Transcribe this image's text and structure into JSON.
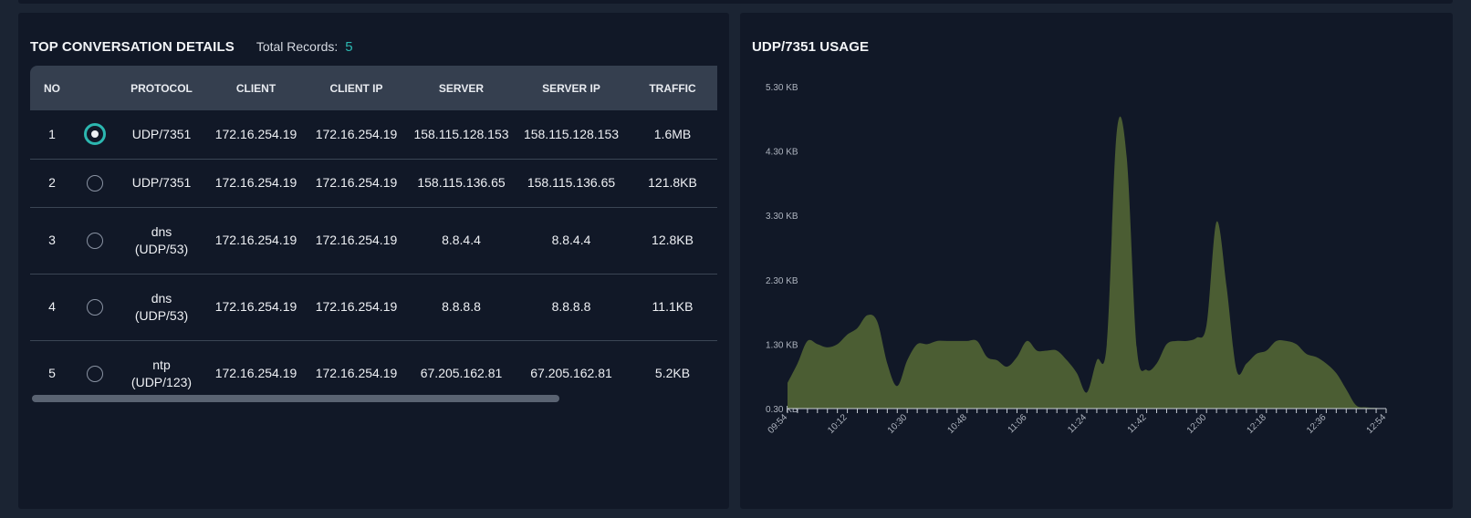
{
  "conversation_panel": {
    "title": "TOP CONVERSATION DETAILS",
    "records_label": "Total Records:",
    "records_count": "5",
    "columns": [
      "NO",
      "",
      "PROTOCOL",
      "CLIENT",
      "CLIENT IP",
      "SERVER",
      "SERVER IP",
      "TRAFFIC"
    ],
    "rows": [
      {
        "no": "1",
        "selected": true,
        "protocol_line1": "UDP/7351",
        "protocol_line2": "",
        "client": "172.16.254.19",
        "client_ip": "172.16.254.19",
        "server": "158.115.128.153",
        "server_ip": "158.115.128.153",
        "traffic": "1.6MB"
      },
      {
        "no": "2",
        "selected": false,
        "protocol_line1": "UDP/7351",
        "protocol_line2": "",
        "client": "172.16.254.19",
        "client_ip": "172.16.254.19",
        "server": "158.115.136.65",
        "server_ip": "158.115.136.65",
        "traffic": "121.8KB"
      },
      {
        "no": "3",
        "selected": false,
        "protocol_line1": "dns",
        "protocol_line2": "(UDP/53)",
        "client": "172.16.254.19",
        "client_ip": "172.16.254.19",
        "server": "8.8.4.4",
        "server_ip": "8.8.4.4",
        "traffic": "12.8KB"
      },
      {
        "no": "4",
        "selected": false,
        "protocol_line1": "dns",
        "protocol_line2": "(UDP/53)",
        "client": "172.16.254.19",
        "client_ip": "172.16.254.19",
        "server": "8.8.8.8",
        "server_ip": "8.8.8.8",
        "traffic": "11.1KB"
      },
      {
        "no": "5",
        "selected": false,
        "protocol_line1": "ntp",
        "protocol_line2": "(UDP/123)",
        "client": "172.16.254.19",
        "client_ip": "172.16.254.19",
        "server": "67.205.162.81",
        "server_ip": "67.205.162.81",
        "traffic": "5.2KB"
      }
    ]
  },
  "usage_panel": {
    "title": "UDP/7351 USAGE"
  },
  "chart_data": {
    "type": "area",
    "title": "UDP/7351 USAGE",
    "xlabel": "",
    "ylabel": "",
    "color": "#4b5d33",
    "ylim": [
      0.3,
      5.3
    ],
    "y_ticks": [
      "0.30 KB",
      "1.30 KB",
      "2.30 KB",
      "3.30 KB",
      "4.30 KB",
      "5.30 KB"
    ],
    "y_tick_values": [
      0.3,
      1.3,
      2.3,
      3.3,
      4.3,
      5.3
    ],
    "x_tick_labels": [
      "09:54",
      "10:12",
      "10:30",
      "10:48",
      "11:06",
      "11:24",
      "11:42",
      "12:00",
      "12:18",
      "12:36",
      "12:54"
    ],
    "x_range_minutes": [
      594,
      774
    ],
    "points": [
      [
        594,
        0.7
      ],
      [
        597,
        1.0
      ],
      [
        600,
        1.35
      ],
      [
        603,
        1.3
      ],
      [
        606,
        1.25
      ],
      [
        609,
        1.3
      ],
      [
        612,
        1.45
      ],
      [
        615,
        1.55
      ],
      [
        618,
        1.75
      ],
      [
        621,
        1.65
      ],
      [
        624,
        1.0
      ],
      [
        627,
        0.65
      ],
      [
        630,
        1.05
      ],
      [
        633,
        1.3
      ],
      [
        636,
        1.3
      ],
      [
        639,
        1.35
      ],
      [
        642,
        1.35
      ],
      [
        645,
        1.35
      ],
      [
        648,
        1.35
      ],
      [
        651,
        1.35
      ],
      [
        654,
        1.1
      ],
      [
        657,
        1.05
      ],
      [
        660,
        0.95
      ],
      [
        663,
        1.1
      ],
      [
        666,
        1.35
      ],
      [
        669,
        1.2
      ],
      [
        672,
        1.2
      ],
      [
        675,
        1.2
      ],
      [
        678,
        1.05
      ],
      [
        681,
        0.85
      ],
      [
        684,
        0.55
      ],
      [
        687,
        1.05
      ],
      [
        690,
        1.3
      ],
      [
        693,
        4.6
      ],
      [
        696,
        4.2
      ],
      [
        699,
        1.25
      ],
      [
        702,
        0.9
      ],
      [
        705,
        1.0
      ],
      [
        708,
        1.3
      ],
      [
        711,
        1.35
      ],
      [
        714,
        1.35
      ],
      [
        717,
        1.4
      ],
      [
        720,
        1.6
      ],
      [
        723,
        3.2
      ],
      [
        726,
        2.2
      ],
      [
        729,
        0.9
      ],
      [
        732,
        1.0
      ],
      [
        735,
        1.15
      ],
      [
        738,
        1.2
      ],
      [
        741,
        1.35
      ],
      [
        744,
        1.35
      ],
      [
        747,
        1.3
      ],
      [
        750,
        1.15
      ],
      [
        753,
        1.1
      ],
      [
        756,
        1.0
      ],
      [
        759,
        0.85
      ],
      [
        762,
        0.6
      ],
      [
        765,
        0.35
      ],
      [
        768,
        0.32
      ],
      [
        771,
        0.31
      ],
      [
        774,
        0.3
      ]
    ]
  }
}
